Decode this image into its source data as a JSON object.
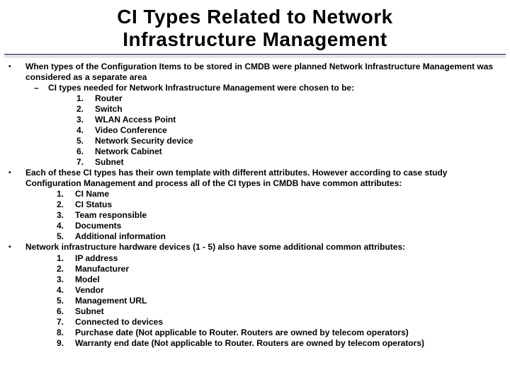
{
  "title_l1": "CI Types Related to Network",
  "title_l2": "Infrastructure Management",
  "p1": "When types of the Configuration Items to be stored in CMDB were planned Network Infrastructure Management was considered as a separate area",
  "p1_sub": "CI types needed for Network Infrastructure Management were chosen to be:",
  "list1": [
    "Router",
    "Switch",
    "WLAN Access Point",
    "Video Conference",
    "Network Security device",
    "Network Cabinet",
    "Subnet"
  ],
  "p2": "Each of these CI types has their own template with different attributes. However according to case study Configuration Management and process all of the CI types in CMDB have common attributes:",
  "list2": [
    "CI Name",
    "CI Status",
    "Team responsible",
    "Documents",
    "Additional information"
  ],
  "p3": "Network infrastructure hardware devices (1 - 5) also have some additional common attributes:",
  "list3": [
    "IP address",
    "Manufacturer",
    "Model",
    "Vendor",
    "Management URL",
    "Subnet",
    "Connected to devices",
    "Purchase date (Not applicable to Router. Routers are owned by telecom operators)",
    "Warranty end date (Not applicable to Router. Routers are owned by telecom operators)"
  ]
}
